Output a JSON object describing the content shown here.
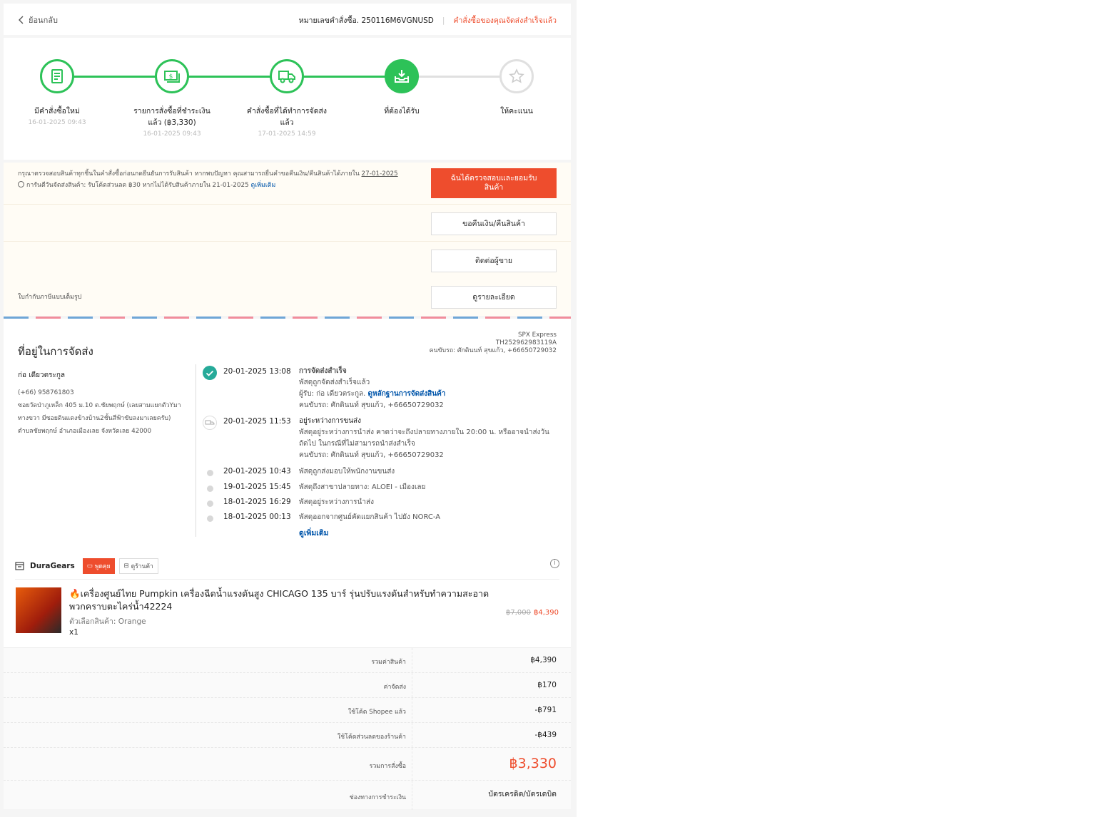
{
  "header": {
    "back_label": "ย้อนกลับ",
    "order_number": "หมายเลขคำสั่งซื้อ. 250116M6VGNUSD",
    "separator": "|",
    "status": "คำสั่งซื้อของคุณจัดส่งสำเร็จแล้ว"
  },
  "stepper": {
    "steps": [
      {
        "icon": "receipt-icon",
        "label": "มีคำสั่งซื้อใหม่",
        "time": "16-01-2025 09:43"
      },
      {
        "icon": "money-icon",
        "label": "รายการสั่งซื้อที่ชำระเงินแล้ว (฿3,330)",
        "time": "16-01-2025 09:43"
      },
      {
        "icon": "truck-icon",
        "label": "คำสั่งซื้อที่ได้ทำการจัดส่งแล้ว",
        "time": "17-01-2025 14:59"
      },
      {
        "icon": "inbox-download-icon",
        "label": "ที่ต้องได้รับ",
        "time": ""
      },
      {
        "icon": "star-icon",
        "label": "ให้คะแนน",
        "time": ""
      }
    ],
    "completed_color": "#2dc258"
  },
  "notice": {
    "text_prefix": "กรุณาตรวจสอบสินค้าทุกชิ้นในคำสั่งซื้อก่อนกดยืนยันการรับสินค้า หากพบปัญหา คุณสามารถยื่นคำขอคืนเงิน/คืนสินค้าได้ภายใน",
    "deadline": "27-01-2025",
    "guarantee": "การันตีวันจัดส่งสินค้า: รับโค้ดส่วนลด ฿30 หากไม่ได้รับสินค้าภายใน 21-01-2025",
    "learn_more": "ดูเพิ่มเติม",
    "confirm_button": "ฉันได้ตรวจสอบและยอมรับสินค้า",
    "refund_button": "ขอคืนเงิน/คืนสินค้า",
    "contact_button": "ติดต่อผู้ขาย",
    "details_button": "ดูรายละเอียด",
    "invoice_text": "ใบกำกับภาษีแบบเต็มรูป"
  },
  "shipping": {
    "title": "ที่อยู่ในการจัดส่ง",
    "carrier": "SPX Express",
    "tracking": "TH252962983119A",
    "driver": "คนขับรถ: ศักดินนท์ สุขแก้ว, +66650729032",
    "recipient_name": "ก่อ เดียวตระกูล",
    "phone": "(+66) 958761803",
    "address": "ซอยวัดป่าภูเหล็ก 405 ม.10 ต.ชัยพฤกษ์ (เลยสามแยกตัวYมาทางขวา มีซอยดินแดงข้างบ้าน2ชั้นสีฟ้าขับลงมาเลยครับ) ตำบลชัยพฤกษ์ อำเภอเมืองเลย จังหวัดเลย 42000",
    "events": [
      {
        "time": "20-01-2025 13:08",
        "title": "การจัดส่งสำเร็จ",
        "line2": "พัสดุถูกจัดส่งสำเร็จแล้ว",
        "line3_prefix": "ผู้รับ: ก่อ เดียวตระกูล. ",
        "line3_link": "ดูหลักฐานการจัดส่งสินค้า",
        "line4": "คนขับรถ: ศักดินนท์ สุขแก้ว, +66650729032"
      },
      {
        "time": "20-01-2025 11:53",
        "title": "อยู่ระหว่างการขนส่ง",
        "line2": "พัสดุอยู่ระหว่างการนำส่ง คาดว่าจะถึงปลายทางภายใน 20:00 น. หรืออาจนำส่งวันถัดไป ในกรณีที่ไม่สามารถนำส่งสำเร็จ",
        "line4": "คนขับรถ: ศักดินนท์ สุขแก้ว, +66650729032"
      },
      {
        "time": "20-01-2025 10:43",
        "text": "พัสดุถูกส่งมอบให้พนักงานขนส่ง"
      },
      {
        "time": "19-01-2025 15:45",
        "text": "พัสดุถึงสาขาปลายทาง: ALOEI - เมืองเลย"
      },
      {
        "time": "18-01-2025 16:29",
        "text": "พัสดุอยู่ระหว่างการนำส่ง"
      },
      {
        "time": "18-01-2025 00:13",
        "text": "พัสดุออกจากศูนย์คัดแยกสินค้า ไปยัง NORC-A"
      }
    ],
    "see_more": "ดูเพิ่มเติม"
  },
  "shop": {
    "name": "DuraGears",
    "chat_label": "พูดคุย",
    "view_shop_label": "ดูร้านค้า"
  },
  "product": {
    "name": "🔥เครื่องศูนย์ไทย Pumpkin เครื่องฉีดน้ำแรงดันสูง CHICAGO 135 บาร์ รุ่นปรับแรงดันสำหรับทำความสะอาด พวกคราบตะไคร่น้ำ42224",
    "variation": "ตัวเลือกสินค้า: Orange",
    "quantity": "x1",
    "original_price": "฿7,000",
    "price": "฿4,390"
  },
  "summary": [
    {
      "label": "รวมค่าสินค้า",
      "value": "฿4,390"
    },
    {
      "label": "ค่าจัดส่ง",
      "value": "฿170"
    },
    {
      "label": "ใช้โค้ด Shopee แล้ว",
      "value": "-฿791"
    },
    {
      "label": "ใช้โค้ดส่วนลดของร้านค้า",
      "value": "-฿439"
    },
    {
      "label": "รวมการสั่งซื้อ",
      "value": "฿3,330"
    },
    {
      "label": "ช่องทางการชำระเงิน",
      "value": "บัตรเครดิต/บัตรเดบิต"
    }
  ],
  "colors": {
    "brand": "#ee4d2d",
    "success": "#26aa99",
    "link": "#0055aa"
  }
}
